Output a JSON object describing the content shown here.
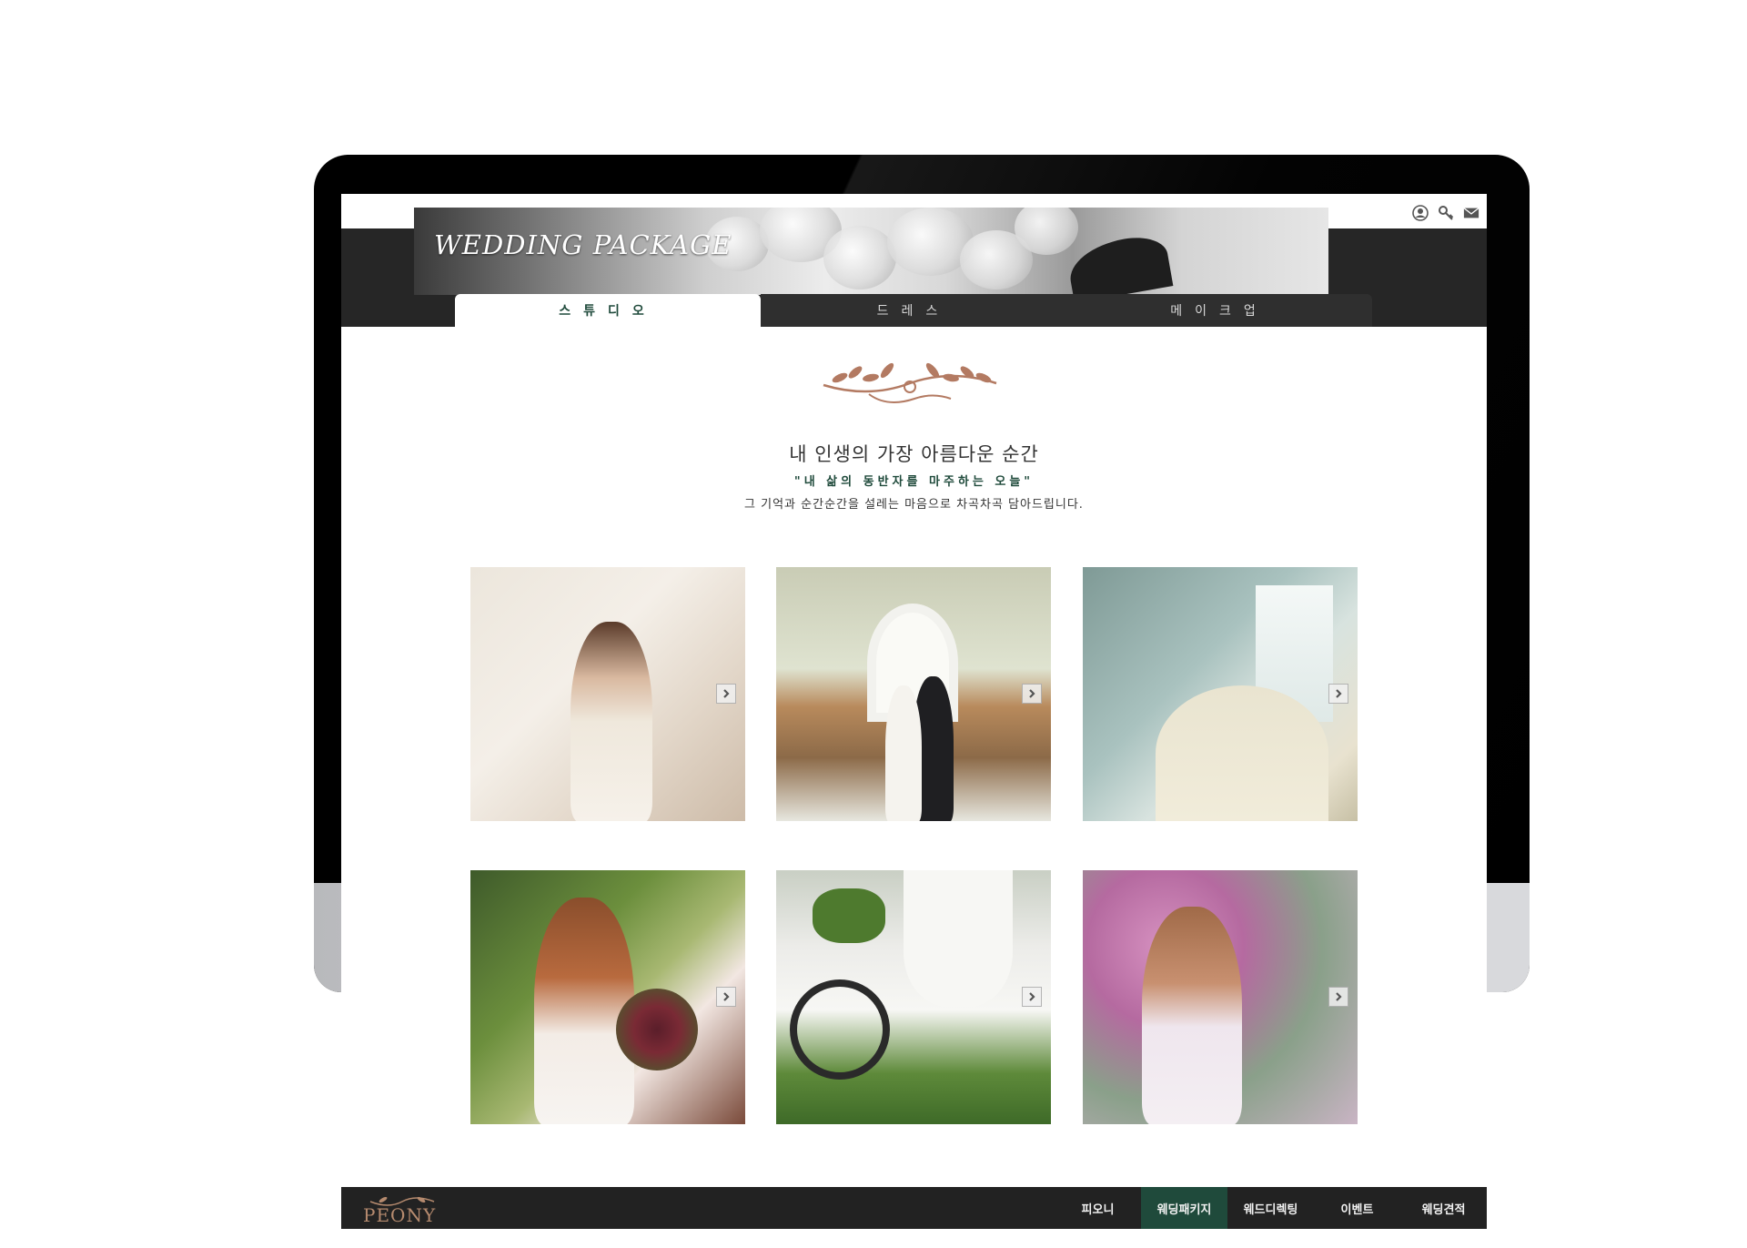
{
  "banner": {
    "title": "WEDDING PACKAGE"
  },
  "top_icons": [
    "user-icon",
    "key-icon",
    "mail-icon"
  ],
  "tabs": [
    {
      "label": "스튜디오",
      "active": true
    },
    {
      "label": "드레스",
      "active": false
    },
    {
      "label": "메이크업",
      "active": false
    }
  ],
  "hero": {
    "headline": "내 인생의 가장 아름다운 순간",
    "quote": "\"내 삶의 동반자를 마주하는 오늘\"",
    "subline": "그 기억과 순간순간을 설레는 마음으로 차곡차곡 담아드립니다."
  },
  "gallery": [
    {
      "name": "bride-on-sofa"
    },
    {
      "name": "couple-kissing-doorway"
    },
    {
      "name": "bride-in-room"
    },
    {
      "name": "bride-with-bouquet"
    },
    {
      "name": "couple-with-bicycle"
    },
    {
      "name": "bride-in-blossoms"
    }
  ],
  "footer": {
    "logo": "PEONY",
    "nav": [
      {
        "label": "피오니",
        "active": false
      },
      {
        "label": "웨딩패키지",
        "active": true
      },
      {
        "label": "웨드디렉팅",
        "active": false
      },
      {
        "label": "이벤트",
        "active": false
      },
      {
        "label": "웨딩견적",
        "active": false
      }
    ]
  },
  "colors": {
    "accent_green": "#1f4a3b",
    "dark_bar": "#262626",
    "ornament_copper": "#b37a62"
  }
}
